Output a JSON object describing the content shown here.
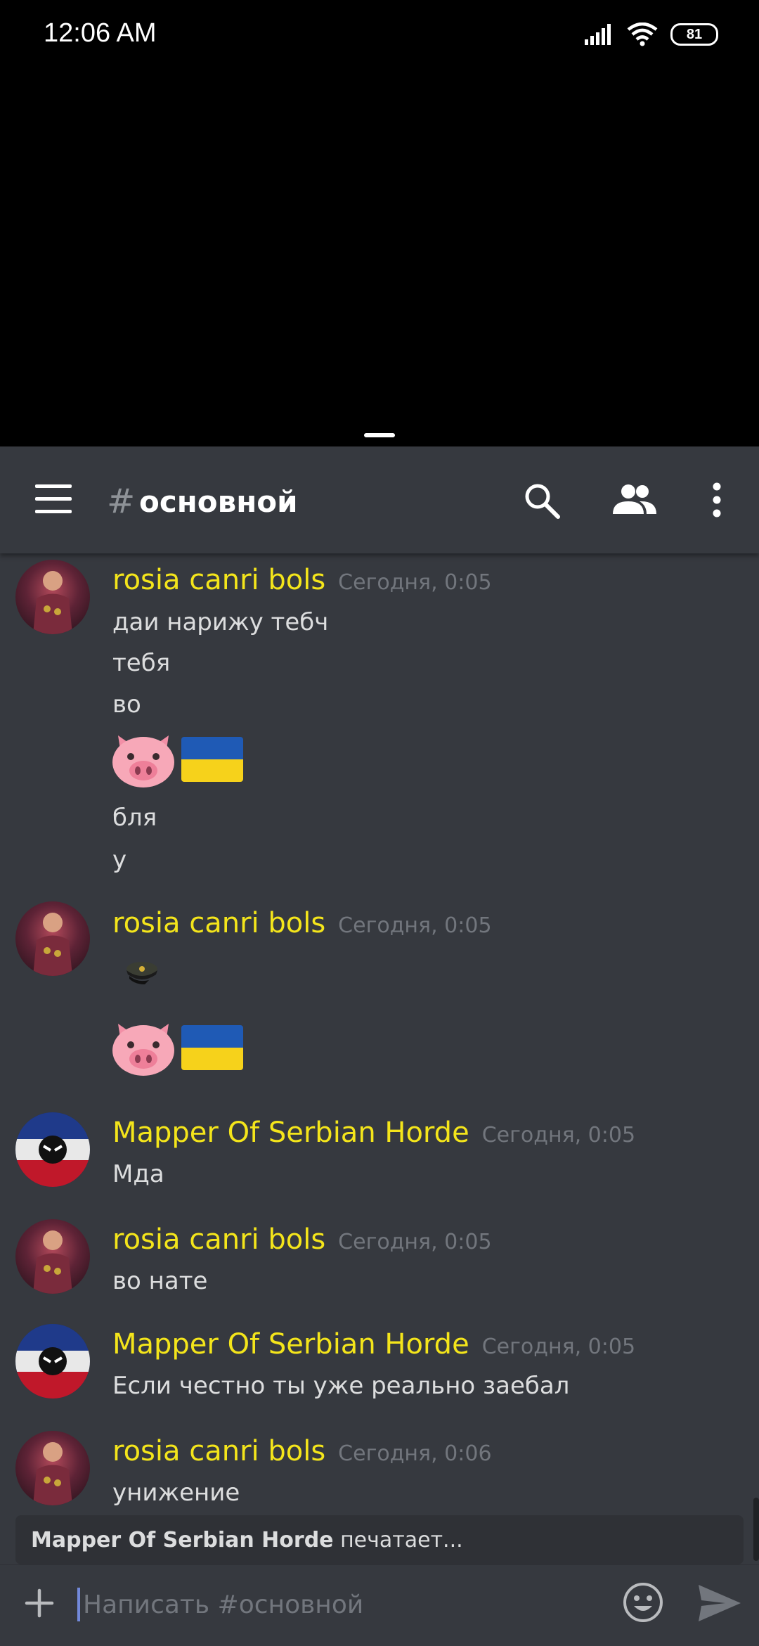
{
  "status_bar": {
    "time": "12:06  AM",
    "battery": "81",
    "icons": [
      "signal-icon",
      "wifi-icon",
      "battery-icon"
    ]
  },
  "header": {
    "channel_hash": "#",
    "channel_name": "основной",
    "icons": [
      "hamburger-menu-icon",
      "search-icon",
      "members-icon",
      "more-vertical-icon"
    ]
  },
  "messages": [
    {
      "author": "rosia canri bols",
      "time": "Сегодня, 0:05",
      "lines": [
        "даи нарижу тебч",
        "тебя",
        "во"
      ],
      "emoji": [
        "pig-face-emoji",
        "ukraine-flag-emoji"
      ],
      "lines_after": [
        "бля",
        "у"
      ]
    },
    {
      "author": "rosia canri bols",
      "time": "Сегодня, 0:05",
      "sticker": "military-cap-emoji",
      "emoji": [
        "pig-face-emoji",
        "ukraine-flag-emoji"
      ]
    },
    {
      "author": "Mapper Of Serbian Horde",
      "time": "Сегодня, 0:05",
      "lines": [
        "Мда"
      ]
    },
    {
      "author": "rosia canri bols",
      "time": "Сегодня, 0:05",
      "lines": [
        "во нате"
      ]
    },
    {
      "author": "Mapper Of Serbian Horde",
      "time": "Сегодня, 0:05",
      "lines": [
        "Если честно ты уже реально заебал"
      ]
    },
    {
      "author": "rosia canri bols",
      "time": "Сегодня, 0:06",
      "lines": [
        "унижение"
      ]
    }
  ],
  "typing": {
    "user": "Mapper Of Serbian Horde",
    "text": " печатает..."
  },
  "composer": {
    "placeholder": "Написать #основной"
  },
  "colors": {
    "background": "#36393f",
    "username": "#f4e51b",
    "timestamp": "#72767d",
    "text": "#dcddde"
  }
}
